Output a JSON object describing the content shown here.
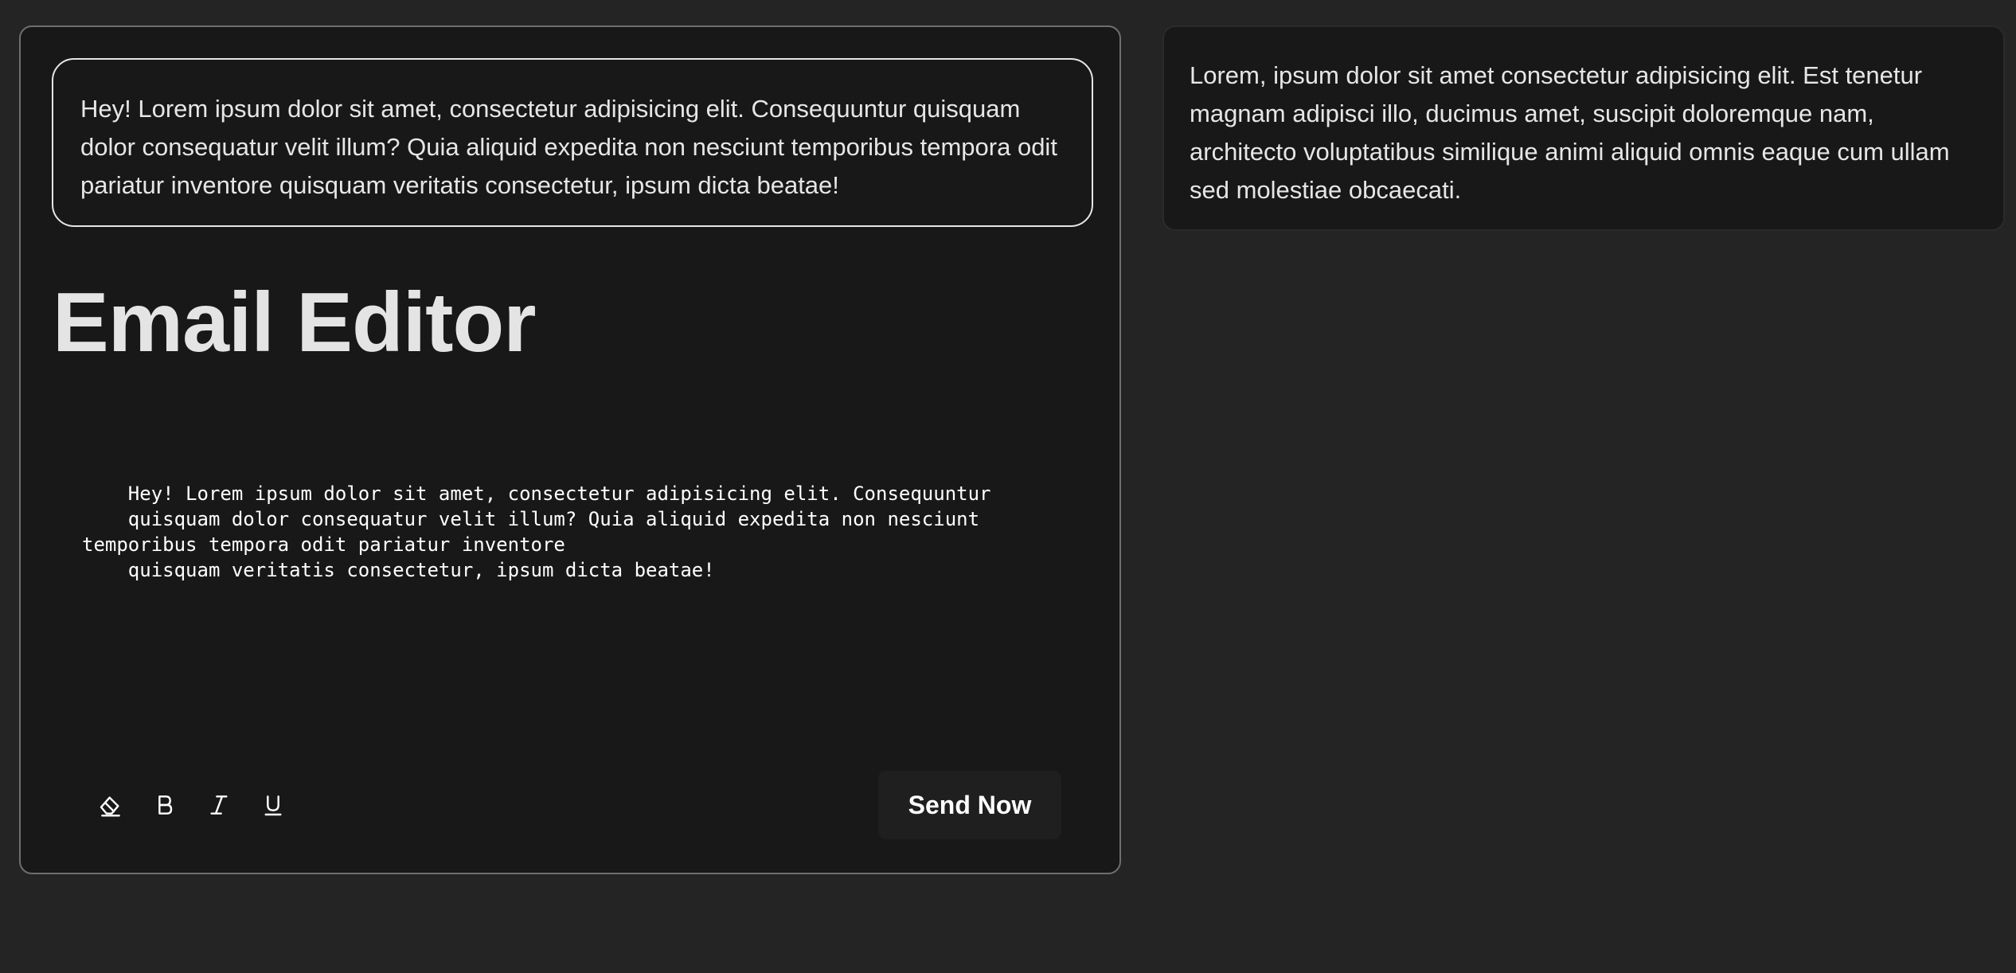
{
  "preview": {
    "text": "Hey! Lorem ipsum dolor sit amet, consectetur adipisicing elit. Consequuntur quisquam dolor consequatur velit illum? Quia aliquid expedita non nesciunt temporibus tempora odit pariatur inventore quisquam veritatis consectetur, ipsum dicta beatae!"
  },
  "editor": {
    "title": "Email Editor",
    "body": "    Hey! Lorem ipsum dolor sit amet, consectetur adipisicing elit. Consequuntur\n    quisquam dolor consequatur velit illum? Quia aliquid expedita non nesciunt\ntemporibus tempora odit pariatur inventore\n    quisquam veritatis consectetur, ipsum dicta beatae!",
    "toolbar": {
      "tools": [
        {
          "name": "eraser-icon",
          "action": "clear-formatting"
        },
        {
          "name": "bold-icon",
          "action": "bold"
        },
        {
          "name": "italic-icon",
          "action": "italic"
        },
        {
          "name": "underline-icon",
          "action": "underline"
        }
      ],
      "send_label": "Send Now"
    }
  },
  "side_panel": {
    "text": "Lorem, ipsum dolor sit amet consectetur adipisicing elit. Est tenetur magnam adipisci illo, ducimus amet, suscipit doloremque nam, architecto voluptatibus similique animi aliquid omnis eaque cum ullam sed molestiae obcaecati."
  },
  "colors": {
    "page_background": "#242424",
    "card_background": "#181818",
    "text": "#e6e6e6",
    "button_background": "#1f1f1f"
  }
}
